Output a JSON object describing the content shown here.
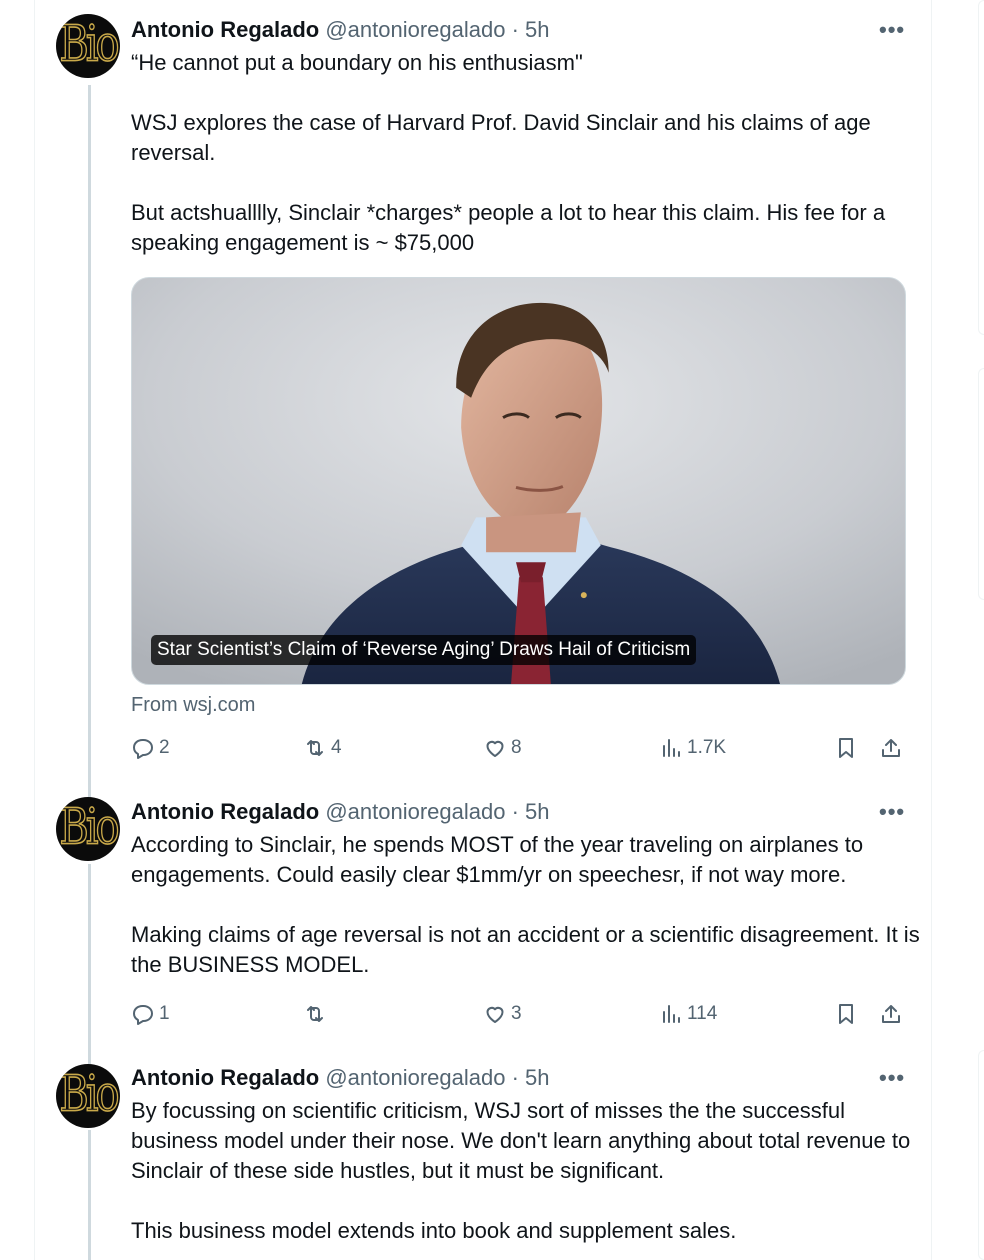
{
  "author": {
    "name": "Antonio Regalado",
    "handle": "@antonioregalado",
    "time": "5h",
    "avatar_text": "Bio",
    "avatar_colors": {
      "background": "#0b0b0b",
      "outline": "#c9a94a"
    }
  },
  "separator": " · ",
  "more_icon": "more-horizontal-icon",
  "tweets": [
    {
      "paragraphs": [
        "“He cannot put a boundary on his enthusiasm\"",
        "WSJ explores the case of Harvard Prof. David Sinclair and his claims of age reversal.",
        "But actshualllly, Sinclair *charges* people a lot to hear this claim. His fee for a speaking engagement is ~ $75,000"
      ],
      "card": {
        "caption": "Star Scientist’s Claim of ‘Reverse Aging’ Draws Hail of Criticism",
        "from": "From wsj.com"
      },
      "stats": {
        "replies": "2",
        "retweets": "4",
        "likes": "8",
        "views": "1.7K"
      }
    },
    {
      "paragraphs": [
        "According to Sinclair, he spends MOST of the year traveling on airplanes to engagements. Could easily clear $1mm/yr on speechesr, if not way more.",
        "Making claims of age reversal is not an accident or a scientific disagreement. It is the BUSINESS MODEL."
      ],
      "stats": {
        "replies": "1",
        "retweets": "",
        "likes": "3",
        "views": "114"
      }
    },
    {
      "paragraphs": [
        "By focussing on scientific criticism, WSJ sort of misses the the successful business model under their nose. We don't learn anything about total revenue to Sinclair of these side hustles, but it must be significant.",
        "This business model extends into book and supplement sales."
      ]
    }
  ],
  "icons": {
    "reply": "reply-icon",
    "retweet": "retweet-icon",
    "like": "heart-icon",
    "views": "views-chart-icon",
    "bookmark": "bookmark-icon",
    "share": "share-icon"
  }
}
